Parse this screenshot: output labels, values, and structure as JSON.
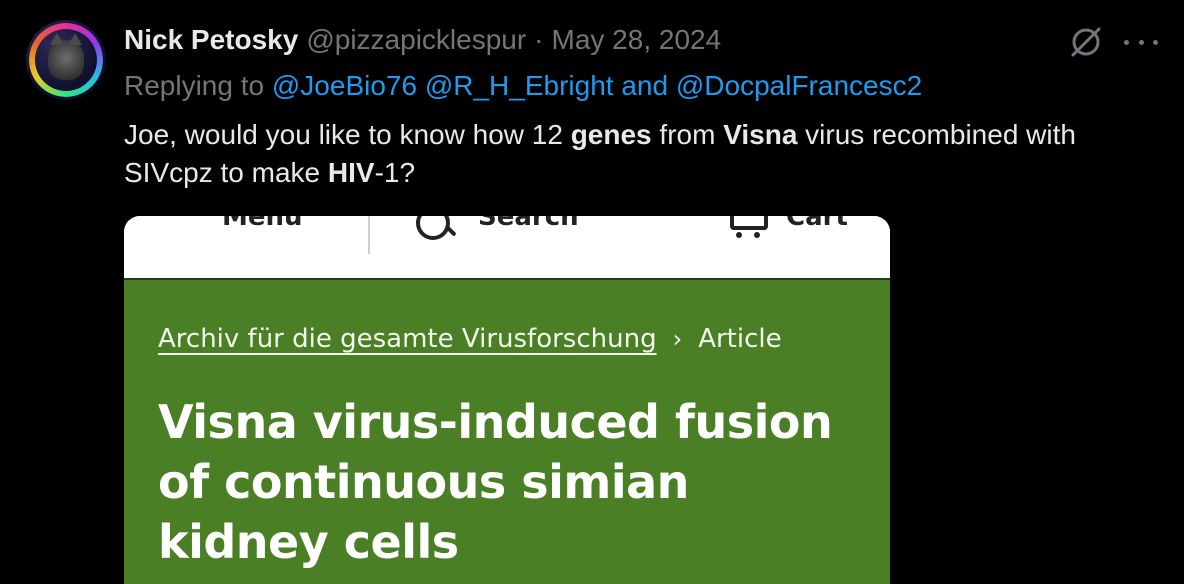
{
  "tweet": {
    "author_name": "Nick Petosky",
    "author_handle": "@pizzapicklespur",
    "separator": "·",
    "date": "May 28, 2024",
    "replying_prefix": "Replying to",
    "reply_mentions": [
      "@JoeBio76",
      "@R_H_Ebright"
    ],
    "reply_and": "and",
    "reply_last_mention": "@DocpalFrancesc2",
    "text": {
      "p1": "Joe, would you like to know how 12 ",
      "b1": "genes",
      "p2": " from ",
      "b2": "Visna",
      "p3": " virus recombined with SIVcpz to make ",
      "b3": "HIV",
      "p4": "-1?"
    }
  },
  "media": {
    "topbar": {
      "menu_label": "Menu",
      "search_label": "Search",
      "cart_label": "Cart"
    },
    "breadcrumb": {
      "journal": "Archiv für die gesamte Virusforschung",
      "separator": "›",
      "current": "Article"
    },
    "article_title": "Visna virus-induced fusion of continuous simian kidney cells",
    "colors": {
      "header_green": "#4a7f25"
    }
  },
  "icons": {
    "grok": "grok-icon",
    "more": "more-icon"
  },
  "colors": {
    "background": "#000000",
    "primary_text": "#e7e9ea",
    "secondary_text": "#71767b",
    "link": "#1d9bf0"
  }
}
